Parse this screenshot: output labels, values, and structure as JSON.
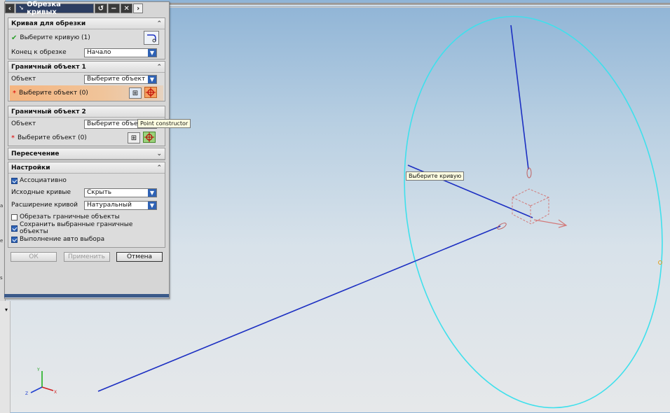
{
  "window": {
    "title": "Обрезка кривых",
    "icons": {
      "back": "chevron-left-icon",
      "curve": "curve-icon",
      "reset": "reset-icon",
      "minimize": "minimize-icon",
      "close": "close-icon",
      "more": "chevron-right-icon"
    }
  },
  "groups": {
    "curve_to_trim": {
      "header": "Кривая для обрезки",
      "select_curve": "Выберите кривую (1)",
      "end_label": "Конец к обрезке",
      "end_value": "Начало"
    },
    "boundary1": {
      "header": "Граничный объект 1",
      "object_label": "Объект",
      "object_value": "Выберите объект",
      "select_object": "Выберите объект (0)"
    },
    "boundary2": {
      "header": "Граничный объект 2",
      "object_label": "Объект",
      "object_value": "Выберите объект",
      "select_object": "Выберите объект (0)"
    },
    "intersection": {
      "header": "Пересечение"
    },
    "settings": {
      "header": "Настройки",
      "associative": {
        "label": "Ассоциативно",
        "checked": true
      },
      "source_curves_label": "Исходные кривые",
      "source_curves_value": "Скрыть",
      "curve_extension_label": "Расширение кривой",
      "curve_extension_value": "Натуральный",
      "trim_boundary": {
        "label": "Обрезать граничные объекты",
        "checked": false
      },
      "keep_boundary": {
        "label": "Сохранить выбранные граничные объекты",
        "checked": true
      },
      "auto_select": {
        "label": "Выполнение авто выбора",
        "checked": true
      }
    }
  },
  "buttons": {
    "ok": "ОК",
    "apply": "Применить",
    "cancel": "Отмена"
  },
  "tooltips": {
    "point_constructor": "Point constructor",
    "select_curve": "Выберите кривую"
  },
  "triad": {
    "x": "X",
    "y": "Y",
    "z": "Z"
  },
  "colors": {
    "curve": "#1c2fc2",
    "circle": "#3fe0ec",
    "accent": "#2f62b4",
    "active_row": "#f5b580"
  }
}
